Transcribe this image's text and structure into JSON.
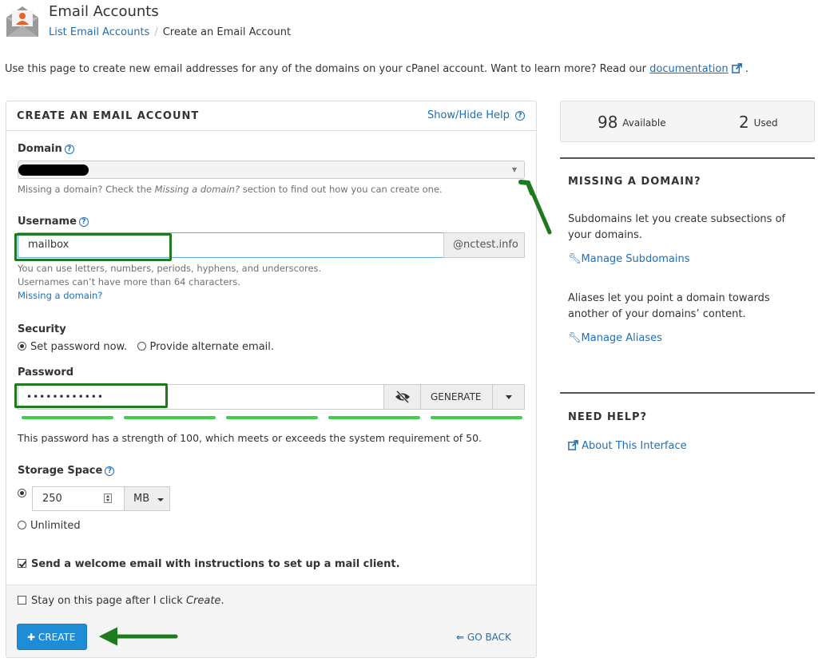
{
  "header": {
    "title": "Email Accounts",
    "breadcrumb": {
      "link": "List Email Accounts",
      "separator": "/",
      "current": "Create an Email Account"
    }
  },
  "intro": {
    "text": "Use this page to create new email addresses for any of the domains on your cPanel account. Want to learn more? Read our ",
    "link": "documentation",
    "end": "."
  },
  "form": {
    "title": "CREATE AN EMAIL ACCOUNT",
    "toggle_help": "Show/Hide Help",
    "domain": {
      "label": "Domain",
      "hint_before": "Missing a domain? Check the ",
      "hint_em": "Missing a domain?",
      "hint_after": " section to find out how you can create one."
    },
    "username": {
      "label": "Username",
      "value": "mailbox",
      "suffix": "@nctest.info",
      "hint1": "You can use letters, numbers, periods, hyphens, and underscores.",
      "hint2": "Usernames can’t have more than 64 characters.",
      "missing_link": "Missing a domain?"
    },
    "security": {
      "label": "Security",
      "option_set": "Set password now.",
      "option_alt": "Provide alternate email.",
      "selected": "set"
    },
    "password": {
      "label": "Password",
      "value": "••••••••••••",
      "generate": "GENERATE",
      "strength_value": 100,
      "strength_segments": 5,
      "strength_text": "This password has a strength of 100, which meets or exceeds the system requirement of 50."
    },
    "storage": {
      "label": "Storage Space",
      "quota": "250",
      "unit": "MB",
      "unlimited": "Unlimited",
      "selected": "quota"
    },
    "welcome": {
      "label": "Send a welcome email with instructions to set up a mail client.",
      "checked": true
    },
    "stay": {
      "label_before": "Stay on this page after I click ",
      "label_em": "Create",
      "label_after": ".",
      "checked": false
    },
    "create_button": "CREATE",
    "go_back": "GO BACK"
  },
  "sidebar": {
    "available_count": "98",
    "available_label": "Available",
    "used_count": "2",
    "used_label": "Used",
    "missing_heading": "MISSING A DOMAIN?",
    "subdomains_text": "Subdomains let you create subsections of your domains.",
    "subdomains_link": "Manage Subdomains",
    "aliases_text": "Aliases let you point a domain towards another of your domains’ content.",
    "aliases_link": "Manage Aliases",
    "help_heading": "NEED HELP?",
    "about_link": "About This Interface"
  },
  "colors": {
    "accent": "#1f8dd6",
    "link": "#1f6fb5",
    "strength_bar": "#3bd14a",
    "annotation": "#1e7a1e"
  },
  "icons": {
    "header": "envelope-user-icon",
    "help": "question-circle-icon",
    "external": "external-link-icon",
    "wrench": "wrench-icon",
    "eye": "eye-slash-icon",
    "plus": "plus-icon",
    "back": "arrow-left-icon"
  }
}
